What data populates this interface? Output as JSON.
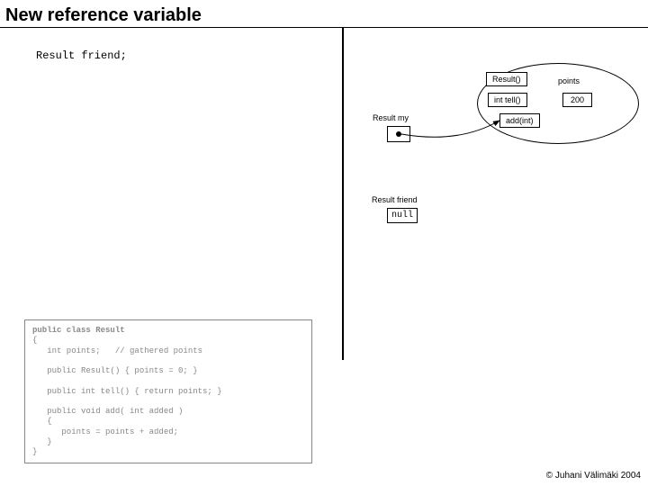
{
  "title": "New reference variable",
  "declaration": "Result friend;",
  "object": {
    "methods": [
      "Result()",
      "int tell()",
      "add(int)"
    ],
    "field_label": "points",
    "field_value": "200"
  },
  "vars": {
    "my_label": "Result my",
    "friend_label": "Result friend",
    "null_text": "null"
  },
  "code": {
    "l1a": "public class ",
    "l1b": "Result",
    "l2": "{",
    "l3": "   int points;   // gathered points",
    "l4": "",
    "l5": "   public Result() { points = 0; }",
    "l6": "",
    "l7": "   public int tell() { return points; }",
    "l8": "",
    "l9": "   public void add( int added )",
    "l10": "   {",
    "l11": "      points = points + added;",
    "l12": "   }",
    "l13": "}"
  },
  "footer": "© Juhani Välimäki 2004"
}
